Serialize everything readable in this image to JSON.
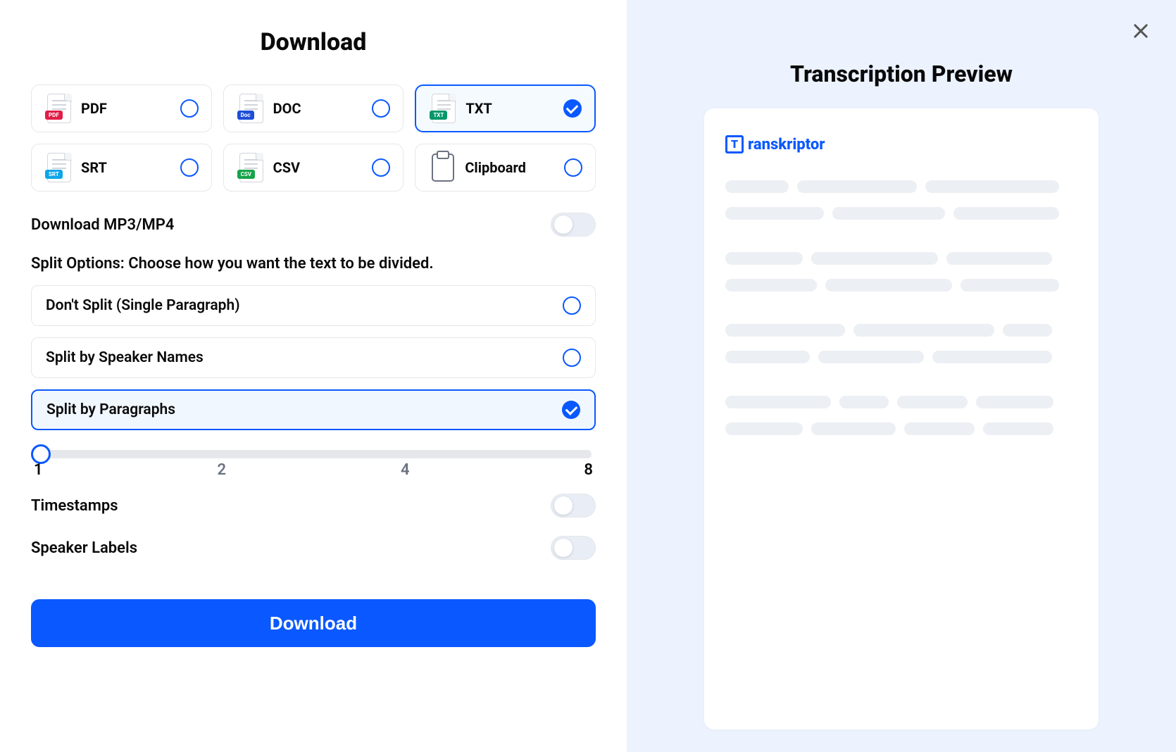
{
  "left": {
    "title": "Download",
    "formats": [
      {
        "key": "pdf",
        "label": "PDF",
        "badge": "PDF",
        "badgeClass": "badge-pdf",
        "selected": false
      },
      {
        "key": "doc",
        "label": "DOC",
        "badge": "Doc",
        "badgeClass": "badge-doc",
        "selected": false
      },
      {
        "key": "txt",
        "label": "TXT",
        "badge": "TXT",
        "badgeClass": "badge-txt",
        "selected": true
      },
      {
        "key": "srt",
        "label": "SRT",
        "badge": "SRT",
        "badgeClass": "badge-srt",
        "selected": false
      },
      {
        "key": "csv",
        "label": "CSV",
        "badge": "CSV",
        "badgeClass": "badge-csv",
        "selected": false
      },
      {
        "key": "clipboard",
        "label": "Clipboard",
        "badge": null,
        "badgeClass": null,
        "selected": false
      }
    ],
    "mp3mp4": {
      "label": "Download MP3/MP4",
      "on": false
    },
    "splitHeading": "Split Options: Choose how you want the text to be divided.",
    "splitOptions": [
      {
        "key": "none",
        "label": "Don't Split (Single Paragraph)",
        "selected": false
      },
      {
        "key": "speaker",
        "label": "Split by Speaker Names",
        "selected": false
      },
      {
        "key": "paragraph",
        "label": "Split by Paragraphs",
        "selected": true
      }
    ],
    "slider": {
      "value": 1,
      "ticks": [
        "1",
        "2",
        "4",
        "8"
      ]
    },
    "timestamps": {
      "label": "Timestamps",
      "on": false
    },
    "speakerLabels": {
      "label": "Speaker Labels",
      "on": false
    },
    "downloadBtn": "Download"
  },
  "right": {
    "title": "Transcription Preview",
    "brand": "ranskriptor",
    "brandInitial": "T"
  }
}
